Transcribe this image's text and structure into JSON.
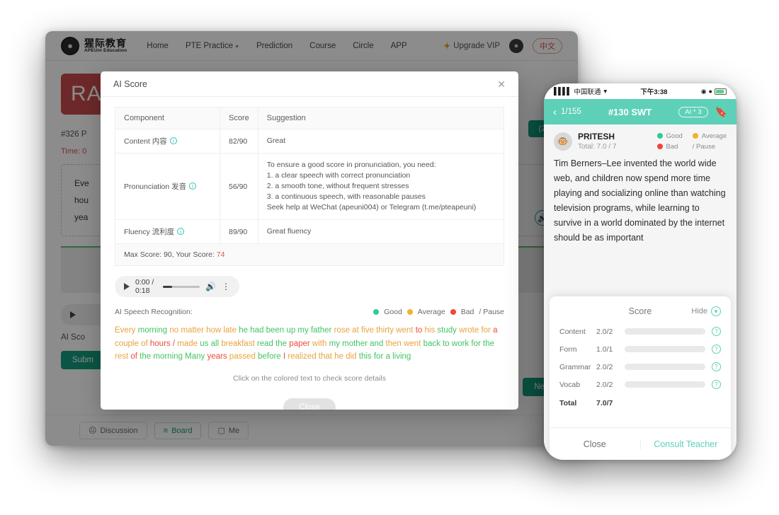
{
  "browser": {
    "nav": {
      "logo_cn": "猩际教育",
      "logo_en": "APEUni Education",
      "links": [
        {
          "label": "Home",
          "caret": false
        },
        {
          "label": "PTE Practice",
          "caret": true
        },
        {
          "label": "Prediction",
          "caret": false
        },
        {
          "label": "Course",
          "caret": false
        },
        {
          "label": "Circle",
          "caret": false
        },
        {
          "label": "APP",
          "caret": false
        }
      ],
      "upgrade_vip": "Upgrade VIP",
      "vip_icon": "crown-icon",
      "lang": "中文"
    },
    "page": {
      "banner": "RA",
      "question_id": "#326 P",
      "time_label": "Time: 0",
      "p6_badge": "(26)",
      "question_lines": [
        "Eve",
        "hou",
        "yea"
      ],
      "ai_score_label": "AI Sco",
      "submit_label": "Subm",
      "next_label": "Next",
      "bottom_items": [
        {
          "label": "Discussion",
          "icon": "comment-icon",
          "active": false
        },
        {
          "label": "Board",
          "icon": "list-icon",
          "active": true
        },
        {
          "label": "Me",
          "icon": "user-icon",
          "active": false
        }
      ]
    }
  },
  "modal": {
    "title": "AI Score",
    "close_icon": "close-icon",
    "table": {
      "headers": [
        "Component",
        "Score",
        "Suggestion"
      ],
      "rows": [
        {
          "component": "Content 内容",
          "score": "82/90",
          "suggestion": [
            "Great"
          ]
        },
        {
          "component": "Pronunciation 发音",
          "score": "56/90",
          "suggestion": [
            "To ensure a good score in pronunciation, you need:",
            "1. a clear speech with correct pronunciation",
            "2. a smooth tone, without frequent stresses",
            "3. a continuous speech, with reasonable pauses",
            "Seek help at WeChat (apeuni004) or Telegram (t.me/pteapeuni)"
          ]
        },
        {
          "component": "Fluency 流利度",
          "score": "89/90",
          "suggestion": [
            "Great fluency"
          ]
        }
      ],
      "max_score_prefix": "Max Score:  90,  Your Score:",
      "your_score": "74"
    },
    "audio": {
      "play_icon": "play-icon",
      "time": "0:00 / 0:18",
      "volume_icon": "volume-icon",
      "more_icon": "kebab-menu-icon"
    },
    "asr_label": "AI Speech Recognition:",
    "legend": [
      {
        "label": "Good",
        "color": "#2ecc8f"
      },
      {
        "label": "Average",
        "color": "#f0b429"
      },
      {
        "label": "Bad",
        "color": "#f0453a"
      },
      {
        "label": "/  Pause",
        "color": ""
      }
    ],
    "transcript_words": [
      {
        "t": "Every",
        "c": "avg"
      },
      {
        "t": "morning",
        "c": "good"
      },
      {
        "t": "no",
        "c": "avg"
      },
      {
        "t": "matter",
        "c": "avg"
      },
      {
        "t": "how",
        "c": "avg"
      },
      {
        "t": "late",
        "c": "avg"
      },
      {
        "t": "he",
        "c": "good"
      },
      {
        "t": "had",
        "c": "good"
      },
      {
        "t": "been",
        "c": "good"
      },
      {
        "t": "up",
        "c": "good"
      },
      {
        "t": "my",
        "c": "good"
      },
      {
        "t": "father",
        "c": "good"
      },
      {
        "t": "rose",
        "c": "avg"
      },
      {
        "t": "at",
        "c": "avg"
      },
      {
        "t": "five",
        "c": "avg"
      },
      {
        "t": "thirty",
        "c": "avg"
      },
      {
        "t": "went",
        "c": "avg"
      },
      {
        "t": "to",
        "c": "bad"
      },
      {
        "t": "his",
        "c": "avg"
      },
      {
        "t": "study",
        "c": "good"
      },
      {
        "t": "wrote",
        "c": "avg"
      },
      {
        "t": "for",
        "c": "avg"
      },
      {
        "t": "a",
        "c": "bad"
      },
      {
        "t": "couple",
        "c": "avg"
      },
      {
        "t": "of",
        "c": "avg"
      },
      {
        "t": "hours",
        "c": "bad"
      },
      {
        "t": "/",
        "c": "bad"
      },
      {
        "t": "made",
        "c": "avg"
      },
      {
        "t": "us",
        "c": "good"
      },
      {
        "t": "all",
        "c": "good"
      },
      {
        "t": "breakfast",
        "c": "avg"
      },
      {
        "t": "read",
        "c": "good"
      },
      {
        "t": "the",
        "c": "good"
      },
      {
        "t": "paper",
        "c": "bad"
      },
      {
        "t": "with",
        "c": "avg"
      },
      {
        "t": "my",
        "c": "good"
      },
      {
        "t": "mother",
        "c": "good"
      },
      {
        "t": "and",
        "c": "good"
      },
      {
        "t": "then",
        "c": "avg"
      },
      {
        "t": "went",
        "c": "avg"
      },
      {
        "t": "back",
        "c": "good"
      },
      {
        "t": "to",
        "c": "good"
      },
      {
        "t": "work",
        "c": "good"
      },
      {
        "t": "for",
        "c": "good"
      },
      {
        "t": "the",
        "c": "good"
      },
      {
        "t": "rest",
        "c": "avg"
      },
      {
        "t": "of",
        "c": "bad"
      },
      {
        "t": "the",
        "c": "good"
      },
      {
        "t": "morning",
        "c": "good"
      },
      {
        "t": "Many",
        "c": "good"
      },
      {
        "t": "years",
        "c": "bad"
      },
      {
        "t": "passed",
        "c": "avg"
      },
      {
        "t": "before",
        "c": "good"
      },
      {
        "t": "I",
        "c": "bad"
      },
      {
        "t": "realized",
        "c": "avg"
      },
      {
        "t": "that",
        "c": "avg"
      },
      {
        "t": "he",
        "c": "avg"
      },
      {
        "t": "did",
        "c": "avg"
      },
      {
        "t": "this",
        "c": "good"
      },
      {
        "t": "for",
        "c": "good"
      },
      {
        "t": "a",
        "c": "good"
      },
      {
        "t": "living",
        "c": "good"
      }
    ],
    "hint": "Click on the colored text to check score details",
    "close_label": "Close"
  },
  "phone": {
    "status": {
      "carrier": "中国联通",
      "wifi_icon": "wifi-icon",
      "time": "下午3:38",
      "location_icon": "location-icon",
      "alarm_icon": "alarm-icon",
      "battery_icon": "battery-icon"
    },
    "header": {
      "back_icon": "back-chevron-icon",
      "count": "1/155",
      "title": "#130 SWT",
      "ai_badge": "AI * 3",
      "bookmark_icon": "bookmark-icon"
    },
    "user": {
      "avatar_icon": "gorilla-avatar-icon",
      "name": "PRITESH",
      "total": "Total: 7.0 / 7"
    },
    "legend": [
      {
        "label": "Good",
        "color": "#4cd08a"
      },
      {
        "label": "Average",
        "color": "#f0b429"
      },
      {
        "label": "Bad",
        "color": "#f0453a"
      },
      {
        "label": "/  Pause",
        "color": ""
      }
    ],
    "passage": "Tim Berners–Lee invented the world wide web, and children now spend more time playing and socializing online than watching television programs, while learning to survive in a world dominated by the internet should be as important",
    "score_card": {
      "title": "Score",
      "hide_label": "Hide",
      "hide_icon": "chevron-down-icon",
      "rows": [
        {
          "name": "Content",
          "value": "2.0/2",
          "pct": 100
        },
        {
          "name": "Form",
          "value": "1.0/1",
          "pct": 100
        },
        {
          "name": "Grammar",
          "value": "2.0/2",
          "pct": 100
        },
        {
          "name": "Vocab",
          "value": "2.0/2",
          "pct": 100
        }
      ],
      "total_label": "Total",
      "total_value": "7.0/7"
    },
    "footer": {
      "close_label": "Close",
      "consult_label": "Consult Teacher"
    }
  }
}
